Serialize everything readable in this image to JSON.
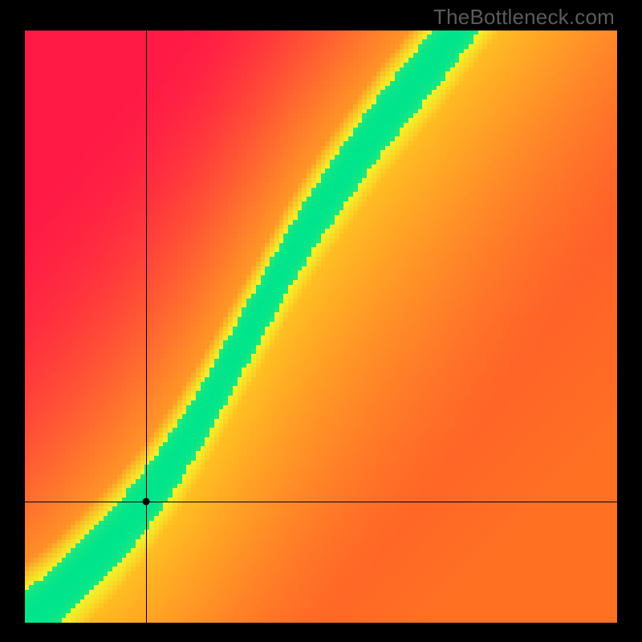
{
  "watermark": "TheBottleneck.com",
  "chart_data": {
    "type": "heatmap",
    "title": "",
    "xlabel": "",
    "ylabel": "",
    "x_range": [
      0,
      1
    ],
    "y_range": [
      0,
      1
    ],
    "crosshair": {
      "x": 0.205,
      "y": 0.205
    },
    "marker": {
      "x": 0.205,
      "y": 0.205
    },
    "curve": [
      [
        0.0,
        0.0
      ],
      [
        0.05,
        0.04
      ],
      [
        0.1,
        0.09
      ],
      [
        0.15,
        0.14
      ],
      [
        0.2,
        0.2
      ],
      [
        0.25,
        0.27
      ],
      [
        0.3,
        0.35
      ],
      [
        0.35,
        0.44
      ],
      [
        0.4,
        0.53
      ],
      [
        0.45,
        0.62
      ],
      [
        0.5,
        0.7
      ],
      [
        0.55,
        0.77
      ],
      [
        0.6,
        0.84
      ],
      [
        0.65,
        0.9
      ],
      [
        0.7,
        0.96
      ],
      [
        0.73,
        1.0
      ]
    ],
    "ridge_halfwidth": 0.052,
    "colorscale_note": "green ridge on red-orange-yellow background",
    "colors": {
      "ridge": "#00e58b",
      "ridge_edge": "#f3f12a",
      "bg_low": "#ff1a45",
      "bg_mid": "#ff7a1f",
      "bg_high": "#ffd31f"
    },
    "pixelation": 128
  }
}
